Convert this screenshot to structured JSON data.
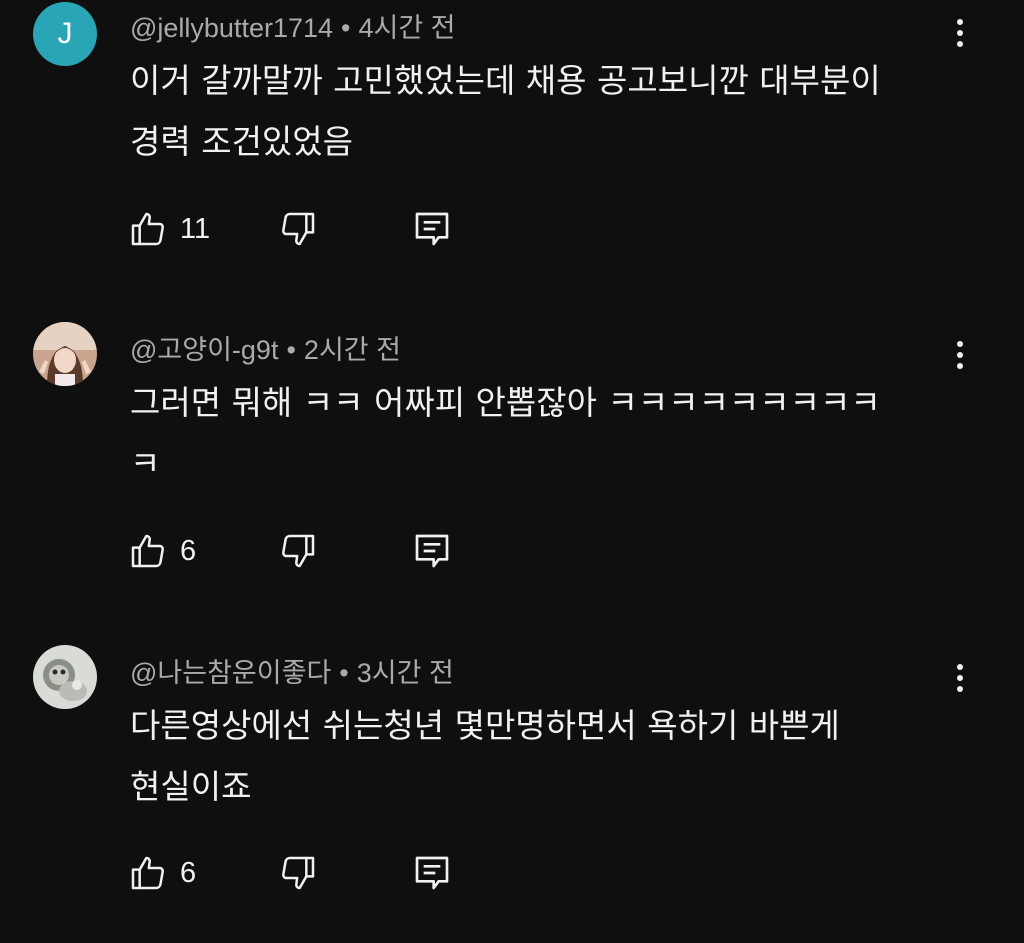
{
  "comments": [
    {
      "handle": "@jellybutter1714",
      "separator": "•",
      "time": "4시간 전",
      "avatar_letter": "J",
      "avatar_color": "#2aa5b5",
      "text": "이거 갈까말까 고민했었는데 채용 공고보니깐 대부분이\n경력 조건있었음",
      "likes": "11"
    },
    {
      "handle": "@고양이-g9t",
      "separator": "•",
      "time": "2시간 전",
      "text": "그러면 뭐해 ㅋㅋ 어짜피 안뽑잖아 ㅋㅋㅋㅋㅋㅋㅋㅋㅋ\nㅋ",
      "likes": "6"
    },
    {
      "handle": "@나는참운이좋다",
      "separator": "•",
      "time": "3시간 전",
      "text": "다른영상에선 쉬는청년 몇만명하면서 욕하기 바쁜게\n현실이죠",
      "likes": "6"
    }
  ],
  "icons": {
    "like": "thumbs-up-icon",
    "dislike": "thumbs-down-icon",
    "reply": "reply-comment-icon",
    "more": "more-vertical-icon"
  },
  "colors": {
    "background": "#0f0f0f",
    "text": "#f1f1f1",
    "meta": "#aaaaaa"
  }
}
